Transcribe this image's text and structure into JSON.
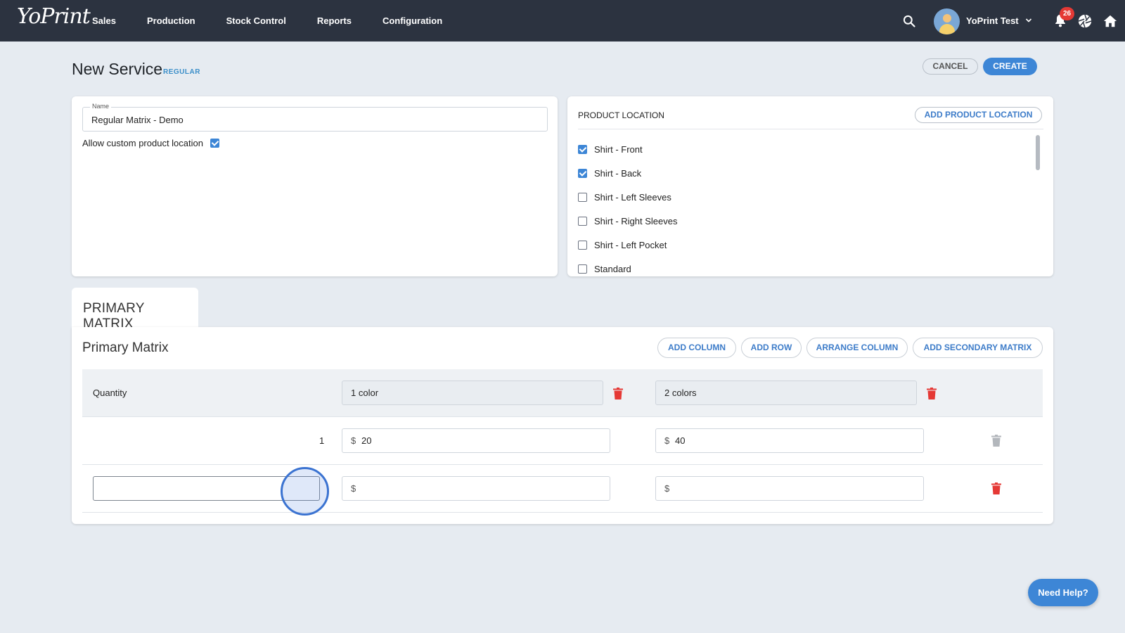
{
  "app": {
    "logo_text": "YoPrint"
  },
  "nav": {
    "items": [
      {
        "label": "Sales"
      },
      {
        "label": "Production"
      },
      {
        "label": "Stock Control"
      },
      {
        "label": "Reports"
      },
      {
        "label": "Configuration"
      }
    ]
  },
  "user": {
    "name": "YoPrint Test",
    "notification_count": "26"
  },
  "icons": {
    "search": "search-icon",
    "dropdown": "chevron-down-icon",
    "notifications": "bell-icon",
    "shutter": "aperture-icon",
    "home": "home-icon",
    "delete": "trash-icon"
  },
  "colors": {
    "topbar": "#2c3340",
    "accent": "#3d86d6",
    "danger": "#e53935",
    "page_bg": "#e6ebf1"
  },
  "header": {
    "title": "New Service",
    "tag": "REGULAR",
    "cancel_label": "CANCEL",
    "create_label": "CREATE"
  },
  "service": {
    "name_label": "Name",
    "name_value": "Regular Matrix - Demo",
    "allow_custom_label": "Allow custom product location",
    "allow_custom_checked": true
  },
  "product_location": {
    "title": "PRODUCT LOCATION",
    "add_label": "ADD PRODUCT LOCATION",
    "items": [
      {
        "label": "Shirt - Front",
        "checked": true
      },
      {
        "label": "Shirt - Back",
        "checked": true
      },
      {
        "label": "Shirt - Left Sleeves",
        "checked": false
      },
      {
        "label": "Shirt - Right Sleeves",
        "checked": false
      },
      {
        "label": "Shirt - Left Pocket",
        "checked": false
      },
      {
        "label": "Standard",
        "checked": false
      }
    ]
  },
  "matrix": {
    "tab_label": "PRIMARY MATRIX",
    "title": "Primary Matrix",
    "buttons": {
      "add_column": "ADD COLUMN",
      "add_row": "ADD ROW",
      "arrange_column": "ARRANGE COLUMN",
      "add_secondary": "ADD SECONDARY MATRIX"
    },
    "quantity_header": "Quantity",
    "columns": [
      {
        "label": "1 color"
      },
      {
        "label": "2 colors"
      }
    ],
    "currency": "$",
    "rows": [
      {
        "quantity": "1",
        "prices": [
          "20",
          "40"
        ]
      },
      {
        "quantity": "",
        "prices": [
          "",
          ""
        ]
      }
    ]
  },
  "help": {
    "label": "Need Help?"
  }
}
